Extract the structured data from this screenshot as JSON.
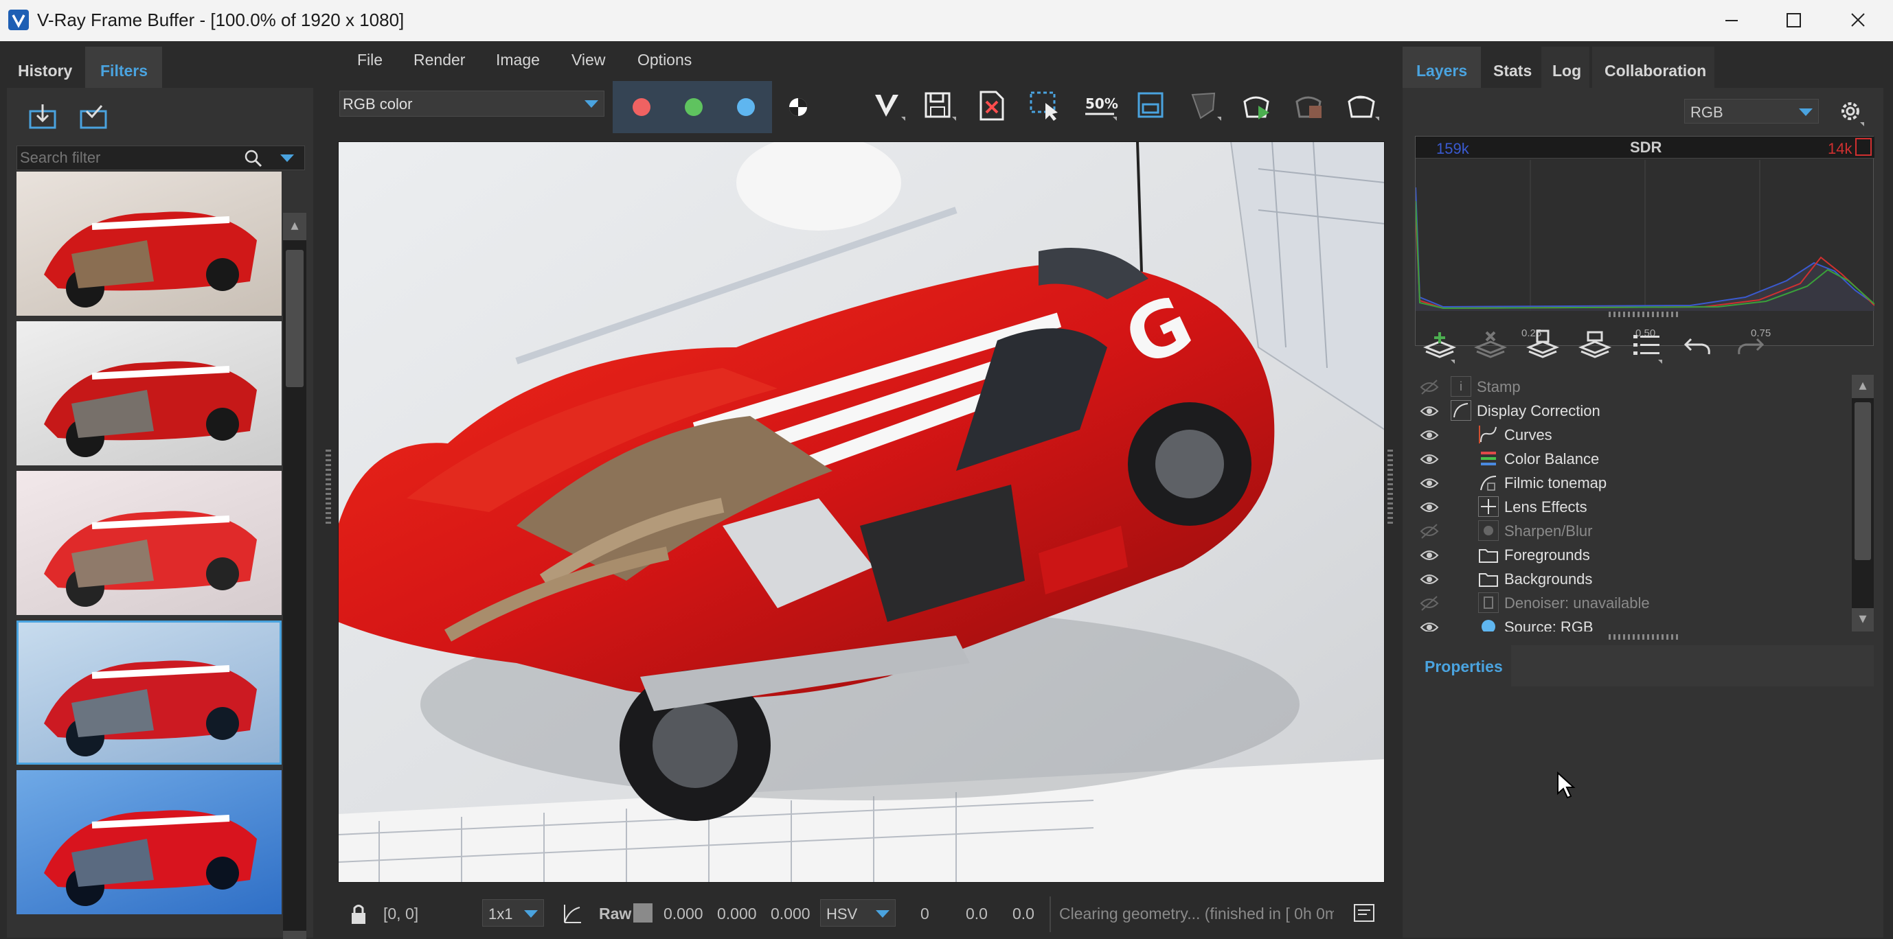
{
  "window": {
    "title": "V-Ray Frame Buffer - [100.0% of 1920 x 1080]",
    "controls": [
      "minimize",
      "maximize",
      "close"
    ]
  },
  "left_panel": {
    "tabs": [
      {
        "label": "History",
        "active": false
      },
      {
        "label": "Filters",
        "active": true
      }
    ],
    "search": {
      "placeholder": "Search filter",
      "value": ""
    },
    "thumbnails": [
      {
        "tone": "warm"
      },
      {
        "tone": "neutral"
      },
      {
        "tone": "faded"
      },
      {
        "tone": "cool",
        "selected": true
      },
      {
        "tone": "blue"
      }
    ]
  },
  "menu": [
    "File",
    "Render",
    "Image",
    "View",
    "Options"
  ],
  "toolbar": {
    "channel_select": "RGB color",
    "channel_buttons": [
      "red-channel",
      "green-channel",
      "blue-channel",
      "alpha-channel"
    ],
    "zoom_label": "50%"
  },
  "status": {
    "coords": "[0, 0]",
    "sampling": "1x1",
    "raw_label": "Raw",
    "values": [
      "0.000",
      "0.000",
      "0.000"
    ],
    "colorspace": "HSV",
    "hsv_values": [
      "0",
      "0.0",
      "0.0"
    ],
    "message": "Clearing geometry... (finished in [ 0h  0m"
  },
  "right_panel": {
    "tabs": [
      {
        "label": "Layers",
        "active": true
      },
      {
        "label": "Stats",
        "active": false
      },
      {
        "label": "Log",
        "active": false
      },
      {
        "label": "Collaboration",
        "active": false
      }
    ],
    "display_select": "RGB",
    "histogram": {
      "left_value": "159k",
      "mode": "SDR",
      "right_value": "14k",
      "ticks": [
        "0.25",
        "0.50",
        "0.75"
      ],
      "colors": {
        "red": "#d03030",
        "green": "#3aa03a",
        "blue": "#3a5ad0"
      }
    },
    "layers": [
      {
        "label": "Stamp",
        "indent": 0,
        "enabled": false
      },
      {
        "label": "Display Correction",
        "indent": 0,
        "enabled": true
      },
      {
        "label": "Curves",
        "indent": 1,
        "enabled": true
      },
      {
        "label": "Color Balance",
        "indent": 1,
        "enabled": true
      },
      {
        "label": "Filmic tonemap",
        "indent": 1,
        "enabled": true
      },
      {
        "label": "Lens Effects",
        "indent": 1,
        "enabled": true
      },
      {
        "label": "Sharpen/Blur",
        "indent": 1,
        "enabled": false
      },
      {
        "label": "Foregrounds",
        "indent": 1,
        "enabled": true
      },
      {
        "label": "Backgrounds",
        "indent": 1,
        "enabled": true
      },
      {
        "label": "Denoiser: unavailable",
        "indent": 1,
        "enabled": false
      },
      {
        "label": "Source: RGB",
        "indent": 1,
        "enabled": true
      }
    ],
    "properties_title": "Properties"
  },
  "colors": {
    "accent": "#4aa3df",
    "panel_bg": "#2b2b2b",
    "car_red": "#d41515"
  }
}
